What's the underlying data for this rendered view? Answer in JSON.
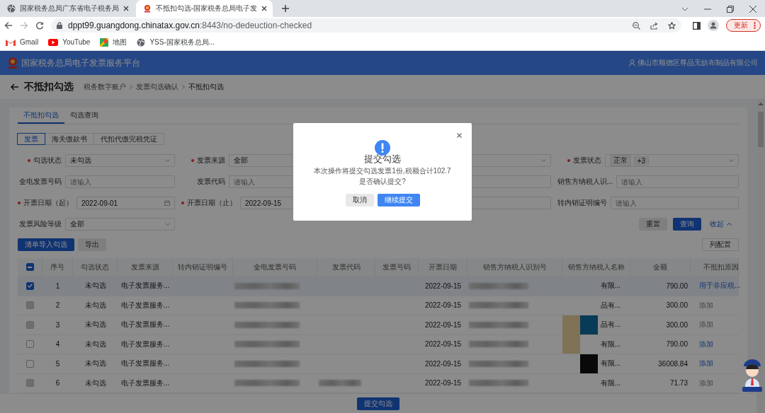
{
  "browser": {
    "tabs": [
      {
        "title": "国家税务总局广东省电子税务局",
        "kind": "globe",
        "selected": false
      },
      {
        "title": "不抵扣勾选-国家税务总局电子发",
        "kind": "emblem",
        "selected": true
      }
    ],
    "address": {
      "host": "dppt99.guangdong.chinatax.gov.cn",
      "path": ":8443/no-dedeuction-checked"
    },
    "bookmarks": [
      {
        "label": "Gmail",
        "kind": "gmail"
      },
      {
        "label": "YouTube",
        "kind": "youtube"
      },
      {
        "label": "地图",
        "kind": "maps"
      },
      {
        "label": "YSS-国家税务总局...",
        "kind": "globe"
      }
    ],
    "update_button": "更新"
  },
  "app": {
    "platform_title": "国家税务总局电子发票服务平台",
    "user": "佛山市顺德区尊品无纺布制品有限公司"
  },
  "page": {
    "title": "不抵扣勾选",
    "breadcrumb": [
      "税务数字账户",
      "发票勾选确认",
      "不抵扣勾选"
    ]
  },
  "tabs": [
    {
      "label": "不抵扣勾选",
      "selected": true
    },
    {
      "label": "勾选查询",
      "selected": false
    }
  ],
  "doc_types": [
    {
      "label": "发票",
      "selected": true
    },
    {
      "label": "海关缴款书",
      "selected": false
    },
    {
      "label": "代扣代缴完税凭证",
      "selected": false
    }
  ],
  "filters": [
    {
      "label": "勾选状态",
      "required": true,
      "kind": "select",
      "value": "未勾选"
    },
    {
      "label": "发票来源",
      "required": true,
      "kind": "select",
      "value": "全部"
    },
    {
      "kind": "select"
    },
    {
      "label": "发票状态",
      "required": true,
      "kind": "tags",
      "tags": [
        "正常",
        "+3"
      ]
    },
    {
      "label": "全电发票号码",
      "required": false,
      "kind": "input",
      "placeholder": "请输入"
    },
    {
      "label": "发票代码",
      "required": false,
      "kind": "input",
      "placeholder": "请输入"
    },
    {
      "kind": "input"
    },
    {
      "label": "销售方纳税人识...",
      "required": false,
      "kind": "input",
      "placeholder": "请输入"
    },
    {
      "label": "开票日期（起）",
      "required": true,
      "kind": "date",
      "value": "2022-09-01"
    },
    {
      "label": "开票日期（止）",
      "required": true,
      "kind": "date",
      "value": "2022-09-15"
    },
    {
      "kind": "input"
    },
    {
      "label": "转内销证明编号",
      "required": false,
      "kind": "input",
      "placeholder": "请输入"
    },
    {
      "label": "发票风险等级",
      "required": false,
      "kind": "select",
      "value": "全部"
    }
  ],
  "filter_actions": {
    "reset": "重置",
    "query": "查询",
    "collapse": "收起"
  },
  "toolbar": {
    "import": "清单导入勾选",
    "export": "导出",
    "columns": "列配置"
  },
  "table": {
    "columns": [
      "序号",
      "勾选状态",
      "发票来源",
      "转内销证明编号",
      "全电发票号码",
      "发票代码",
      "发票号码",
      "开票日期",
      "销售方纳税人识别号",
      "销售方纳税人名称",
      "金额",
      "不抵扣原因"
    ],
    "select_all": {
      "indeterminate": true
    },
    "rows": [
      {
        "selected": true,
        "disabled": false,
        "no": "1",
        "status": "未勾选",
        "source": "电子发票服务...",
        "date": "2022-09-15",
        "seller_name": "有限...",
        "amount": "790.00",
        "reason": "用于非应税...",
        "reason_enabled": true
      },
      {
        "selected": false,
        "disabled": true,
        "no": "2",
        "status": "未勾选",
        "source": "电子发票服务...",
        "date": "2022-09-15",
        "seller_name": "品有...",
        "amount": "300.00",
        "reason": "添加",
        "reason_enabled": false
      },
      {
        "selected": false,
        "disabled": true,
        "no": "3",
        "status": "未勾选",
        "source": "电子发票服务...",
        "date": "2022-09-15",
        "seller_name": "品有...",
        "amount": "300.00",
        "reason": "添加",
        "reason_enabled": false
      },
      {
        "selected": false,
        "disabled": false,
        "no": "4",
        "status": "未勾选",
        "source": "电子发票服务...",
        "date": "2022-09-15",
        "seller_name": "有限...",
        "amount": "790.00",
        "reason": "添加",
        "reason_enabled": true
      },
      {
        "selected": false,
        "disabled": false,
        "no": "5",
        "status": "未勾选",
        "source": "电子发票服务...",
        "date": "2022-09-15",
        "seller_name": "有限...",
        "amount": "36008.84",
        "reason": "添加",
        "reason_enabled": true
      },
      {
        "selected": false,
        "disabled": true,
        "no": "6",
        "status": "未勾选",
        "source": "电子发票服务...",
        "date": "2022-09-15",
        "seller_name": "有限...",
        "amount": "71.73",
        "reason": "添加",
        "reason_enabled": false
      }
    ]
  },
  "submit_button": "提交勾选",
  "dialog": {
    "title": "提交勾选",
    "message": "本次操作将提交勾选发票1份,税额合计102.7",
    "question": "是否确认提交?",
    "cancel": "取消",
    "confirm": "继续提交"
  }
}
